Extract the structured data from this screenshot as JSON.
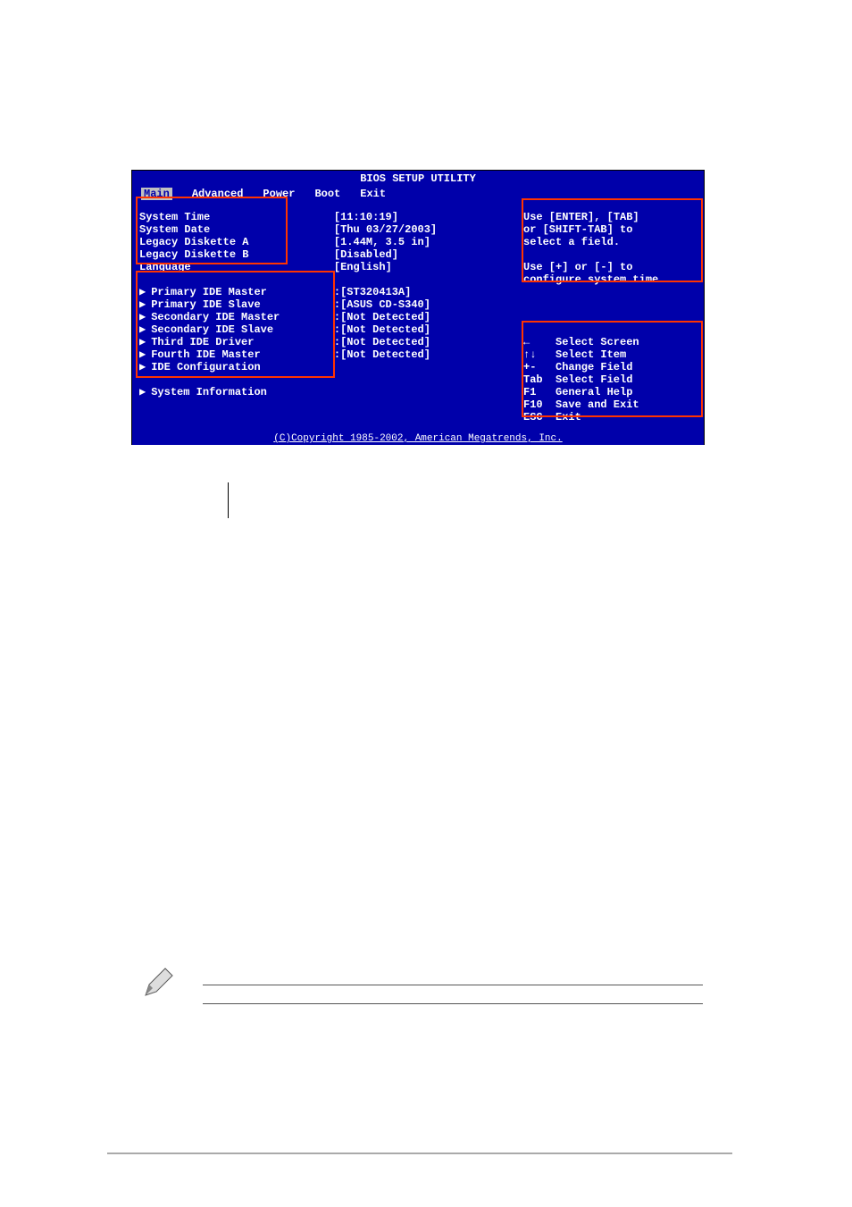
{
  "title": "BIOS SETUP UTILITY",
  "tabs": [
    "Main",
    "Advanced",
    "Power",
    "Boot",
    "Exit"
  ],
  "active_tab": "Main",
  "fields": [
    {
      "label": "System Time",
      "value": "[11:10:19]"
    },
    {
      "label": "System Date",
      "value": "[Thu 03/27/2003]"
    },
    {
      "label": "Legacy Diskette A",
      "value": "[1.44M, 3.5 in]"
    },
    {
      "label": "Legacy Diskette B",
      "value": "[Disabled]"
    },
    {
      "label": "Language",
      "value": "[English]"
    }
  ],
  "submenus": [
    {
      "label": "Primary IDE Master",
      "value": ":[ST320413A]"
    },
    {
      "label": "Primary IDE Slave",
      "value": ":[ASUS CD-S340]"
    },
    {
      "label": "Secondary IDE Master",
      "value": ":[Not Detected]"
    },
    {
      "label": "Secondary IDE Slave",
      "value": ":[Not Detected]"
    },
    {
      "label": "Third IDE Driver",
      "value": ":[Not Detected]"
    },
    {
      "label": "Fourth IDE Master",
      "value": ":[Not Detected]"
    },
    {
      "label": "IDE Configuration",
      "value": ""
    },
    {
      "label": "",
      "value": ""
    },
    {
      "label": "System Information",
      "value": ""
    }
  ],
  "help": {
    "line1": "Use [ENTER], [TAB]",
    "line2": "or [SHIFT-TAB] to",
    "line3": "select a field.",
    "line4": "",
    "line5": "Use [+] or [-] to",
    "line6": "configure system time."
  },
  "nav": [
    {
      "key": "←",
      "desc": "Select Screen"
    },
    {
      "key": "↑↓",
      "desc": "Select Item"
    },
    {
      "key": "+-",
      "desc": "Change Field"
    },
    {
      "key": "Tab",
      "desc": "Select Field"
    },
    {
      "key": "F1",
      "desc": "General Help"
    },
    {
      "key": "F10",
      "desc": "Save and Exit"
    },
    {
      "key": "ESC",
      "desc": "Exit"
    }
  ],
  "copyright": "(C)Copyright 1985-2002, American Megatrends, Inc."
}
